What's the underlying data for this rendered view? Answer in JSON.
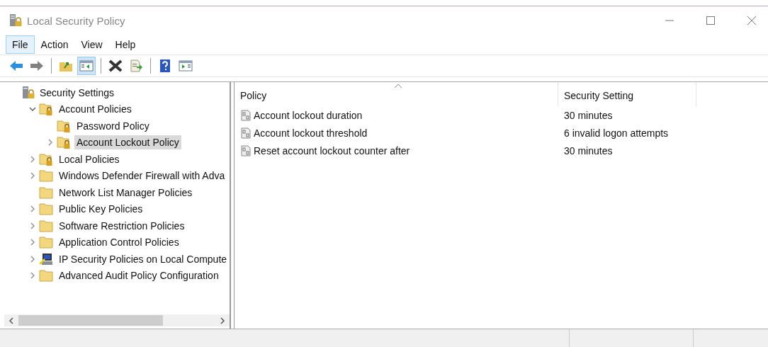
{
  "window": {
    "title": "Local Security Policy"
  },
  "menu": [
    {
      "label": "File",
      "selected": true
    },
    {
      "label": "Action",
      "selected": false
    },
    {
      "label": "View",
      "selected": false
    },
    {
      "label": "Help",
      "selected": false
    }
  ],
  "toolbar": [
    {
      "kind": "back",
      "selected": false
    },
    {
      "kind": "forward",
      "selected": false
    },
    {
      "kind": "separator"
    },
    {
      "kind": "up",
      "selected": false
    },
    {
      "kind": "pane",
      "selected": true
    },
    {
      "kind": "separator"
    },
    {
      "kind": "delete",
      "selected": false
    },
    {
      "kind": "export",
      "selected": false
    },
    {
      "kind": "separator"
    },
    {
      "kind": "help",
      "selected": false
    },
    {
      "kind": "panel",
      "selected": false
    }
  ],
  "tree": [
    {
      "label": "Security Settings",
      "kind": "server",
      "selected": false,
      "children": [
        {
          "label": "Account Policies",
          "kind": "locked-folder",
          "selected": false,
          "expanded": true,
          "children": [
            {
              "label": "Password Policy",
              "kind": "locked-folder",
              "selected": false
            },
            {
              "label": "Account Lockout Policy",
              "kind": "locked-folder",
              "selected": true,
              "expanded": false
            }
          ]
        },
        {
          "label": "Local Policies",
          "kind": "locked-folder",
          "selected": false,
          "expanded": false
        },
        {
          "label": "Windows Defender Firewall with Adva",
          "kind": "folder",
          "selected": false,
          "expanded": false
        },
        {
          "label": "Network List Manager Policies",
          "kind": "folder",
          "selected": false
        },
        {
          "label": "Public Key Policies",
          "kind": "folder",
          "selected": false,
          "expanded": false
        },
        {
          "label": "Software Restriction Policies",
          "kind": "folder",
          "selected": false,
          "expanded": false
        },
        {
          "label": "Application Control Policies",
          "kind": "folder",
          "selected": false,
          "expanded": false
        },
        {
          "label": "IP Security Policies on Local Compute",
          "kind": "computer",
          "selected": false,
          "expanded": false
        },
        {
          "label": "Advanced Audit Policy Configuration",
          "kind": "folder",
          "selected": false,
          "expanded": false
        }
      ]
    }
  ],
  "columns": [
    {
      "label": "Policy",
      "sorted": true
    },
    {
      "label": "Security Setting",
      "sorted": false
    }
  ],
  "rows": [
    {
      "policy": "Account lockout duration",
      "setting": "30 minutes"
    },
    {
      "policy": "Account lockout threshold",
      "setting": "6 invalid logon attempts"
    },
    {
      "policy": "Reset account lockout counter after",
      "setting": "30 minutes"
    }
  ]
}
